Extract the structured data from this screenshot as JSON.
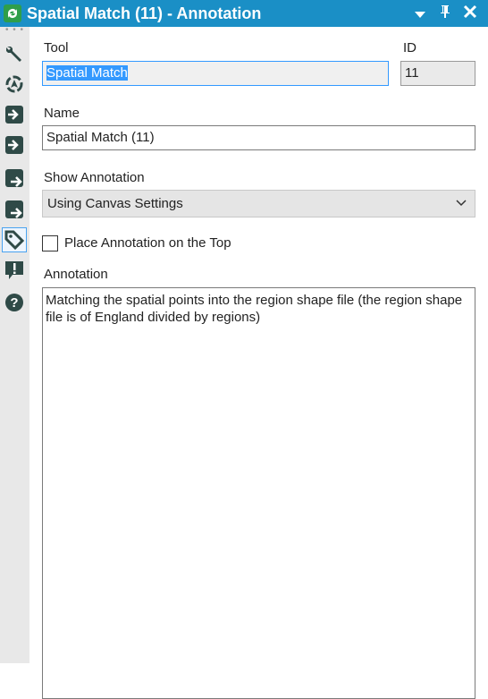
{
  "titlebar": {
    "title": "Spatial Match (11) - Annotation",
    "dropdown_icon": "triangle-down",
    "pin_icon": "pin",
    "close_icon": "close"
  },
  "sidebar": {
    "items": [
      {
        "icon": "wrench-icon"
      },
      {
        "icon": "navigator-icon"
      },
      {
        "icon": "input-arrow-icon"
      },
      {
        "icon": "input-arrow-icon"
      },
      {
        "icon": "output-arrow-icon"
      },
      {
        "icon": "output-arrow-icon"
      },
      {
        "icon": "tag-icon",
        "selected": true
      },
      {
        "icon": "alert-icon"
      },
      {
        "icon": "help-icon"
      }
    ]
  },
  "form": {
    "tool_label": "Tool",
    "tool_value": "Spatial Match",
    "id_label": "ID",
    "id_value": "11",
    "name_label": "Name",
    "name_value": "Spatial Match (11)",
    "show_annotation_label": "Show Annotation",
    "show_annotation_value": "Using Canvas Settings",
    "place_on_top_label": "Place Annotation on the Top",
    "place_on_top_checked": false,
    "annotation_label": "Annotation",
    "annotation_value": "Matching the spatial points into the region shape file (the region shape file is of England divided by regions)"
  },
  "colors": {
    "titlebar": "#1a8fc6",
    "icon": "#2f4a47",
    "selection": "#3399ff"
  }
}
